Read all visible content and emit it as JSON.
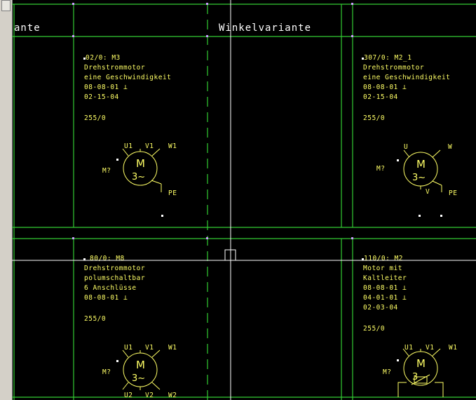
{
  "header": {
    "left_fragment": "ante",
    "center_title": "Winkelvariante"
  },
  "cells": [
    {
      "lines": [
        "02/0: M3",
        "Drehstrommotor",
        "eine Geschwindigkeit",
        "08-08-01 ⊥",
        "02-15-04"
      ],
      "code": "255/0",
      "symbol": {
        "label": "M?",
        "center": "M",
        "phase": "3~",
        "top_terminals": [
          "U1",
          "V1",
          "W1"
        ],
        "bottom_terminals": [],
        "pe": "PE"
      }
    },
    {
      "lines": [
        "307/0: M2_1",
        "Drehstrommotor",
        "eine Geschwindigkeit",
        "08-08-01 ⊥",
        "02-15-04"
      ],
      "code": "255/0",
      "symbol": {
        "label": "M?",
        "center": "M",
        "phase": "3~",
        "top_terminals": [
          "U",
          "W"
        ],
        "bottom_terminals": [
          "V"
        ],
        "pe": "PE"
      }
    },
    {
      "lines": [
        "80/0: M8",
        "Drehstrommotor",
        "polumschaltbar",
        "6 Anschlüsse",
        "08-08-01 ⊥"
      ],
      "code": "255/0",
      "symbol": {
        "label": "M?",
        "center": "M",
        "phase": "3~",
        "top_terminals": [
          "U1",
          "V1",
          "W1"
        ],
        "bottom_terminals": [
          "U2",
          "V2",
          "W2"
        ],
        "pe": ""
      }
    },
    {
      "lines": [
        "110/0: M2",
        "Motor mit",
        "Kaltleiter",
        "08-08-01 ⊥",
        "04-01-01 ⊥",
        "02-03-04"
      ],
      "code": "255/0",
      "symbol": {
        "label": "M?",
        "center": "M",
        "phase": "3",
        "top_terminals": [
          "U1",
          "V1",
          "W1"
        ],
        "bottom_terminals": [],
        "pe": ""
      }
    }
  ],
  "colors": {
    "background": "#000000",
    "grid": "#33cc33",
    "text": "#ffff66",
    "crosshair": "#ffffff",
    "sidebar": "#d4d0c8"
  }
}
